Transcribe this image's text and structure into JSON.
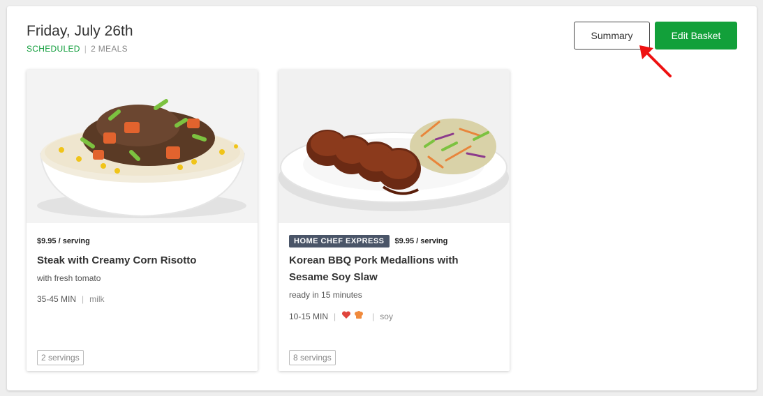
{
  "header": {
    "date": "Friday, July 26th",
    "status": "SCHEDULED",
    "meal_count": "2 MEALS"
  },
  "buttons": {
    "summary": "Summary",
    "edit_basket": "Edit Basket"
  },
  "colors": {
    "accent_green": "#12a03a",
    "status_green": "#0f9d3a",
    "badge_bg": "#4a5568",
    "arrow_red": "#ee1111"
  },
  "meals": [
    {
      "price": "$9.95 / serving",
      "badge": "",
      "title": "Steak with Creamy Corn Risotto",
      "subtitle": "with fresh tomato",
      "time": "35-45 MIN",
      "icons": [],
      "allergen": "milk",
      "servings": "2 servings"
    },
    {
      "price": "$9.95 / serving",
      "badge": "HOME CHEF EXPRESS",
      "title": "Korean BBQ Pork Medallions with Sesame Soy Slaw",
      "subtitle": "ready in 15 minutes",
      "time": "10-15 MIN",
      "icons": [
        "heart-icon",
        "chef-hat-icon"
      ],
      "allergen": "soy",
      "servings": "8 servings"
    }
  ]
}
